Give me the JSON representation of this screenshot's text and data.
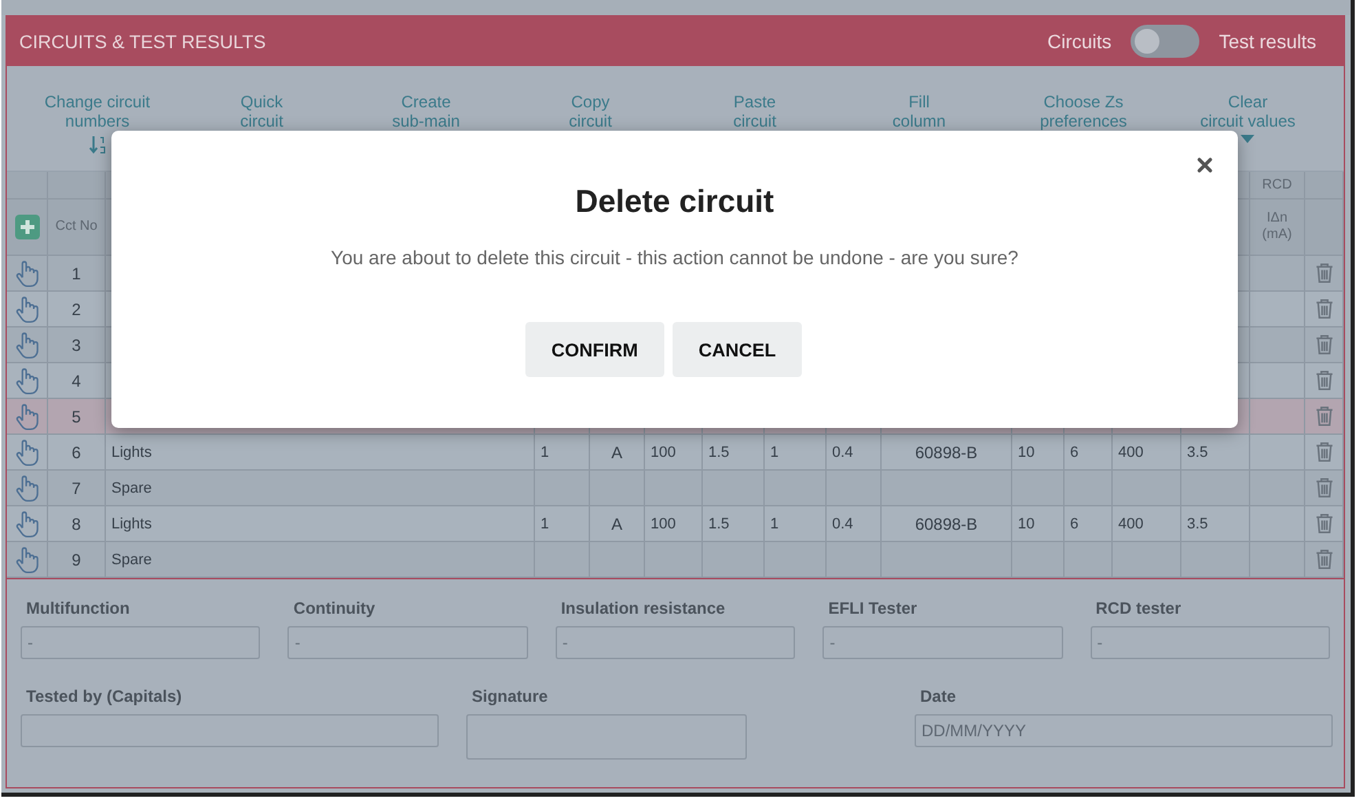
{
  "header": {
    "title": "CIRCUITS & TEST RESULTS",
    "toggle": {
      "left_label": "Circuits",
      "right_label": "Test results",
      "on": false
    }
  },
  "toolbar": [
    {
      "label": "Change circuit\nnumbers",
      "kind": "sort"
    },
    {
      "label": "Quick\ncircuit",
      "kind": "plain"
    },
    {
      "label": "Create\nsub-main",
      "kind": "plain"
    },
    {
      "label": "Copy\ncircuit",
      "kind": "plain"
    },
    {
      "label": "Paste\ncircuit",
      "kind": "plain"
    },
    {
      "label": "Fill\ncolumn",
      "kind": "plain"
    },
    {
      "label": "Choose Zs\npreferences",
      "kind": "plain"
    },
    {
      "label": "Clear\ncircuit values",
      "kind": "caret"
    }
  ],
  "table": {
    "cct_header": "Cct No",
    "rcd_group": "RCD",
    "rcd_header": "IΔn (mA)",
    "rows": [
      {
        "cct": "1",
        "selected": false
      },
      {
        "cct": "2",
        "selected": false
      },
      {
        "cct": "3",
        "selected": false
      },
      {
        "cct": "4",
        "selected": false
      },
      {
        "cct": "5",
        "selected": true
      },
      {
        "cct": "6",
        "description": "Lights",
        "values": [
          "1",
          "A",
          "100",
          "1.5",
          "1",
          "0.4",
          "60898-B",
          "10",
          "6",
          "400",
          "3.5"
        ],
        "selected": false
      },
      {
        "cct": "7",
        "description": "Spare",
        "selected": false
      },
      {
        "cct": "8",
        "description": "Lights",
        "values": [
          "1",
          "A",
          "100",
          "1.5",
          "1",
          "0.4",
          "60898-B",
          "10",
          "6",
          "400",
          "3.5"
        ],
        "selected": false
      },
      {
        "cct": "9",
        "description": "Spare",
        "selected": false
      }
    ]
  },
  "instruments": [
    {
      "label": "Multifunction",
      "value": "-"
    },
    {
      "label": "Continuity",
      "value": "-"
    },
    {
      "label": "Insulation resistance",
      "value": "-"
    },
    {
      "label": "EFLI Tester",
      "value": "-"
    },
    {
      "label": "RCD tester",
      "value": "-"
    }
  ],
  "signoff": [
    {
      "label": "Tested by (Capitals)",
      "kind": "text"
    },
    {
      "label": "Signature",
      "kind": "signature"
    },
    {
      "label": "Date",
      "kind": "text",
      "placeholder": "DD/MM/YYYY"
    }
  ],
  "dialog": {
    "title": "Delete circuit",
    "message": "You are about to delete this circuit - this action cannot be undone - are you sure?",
    "buttons": [
      "CONFIRM",
      "CANCEL"
    ]
  }
}
